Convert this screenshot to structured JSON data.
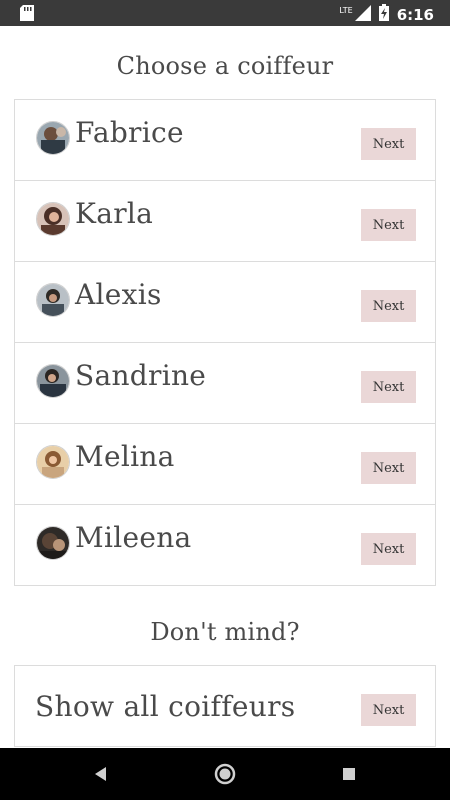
{
  "statusbar": {
    "network": "LTE",
    "time": "6:16"
  },
  "title": "Choose a coiffeur",
  "coiffeurs": [
    {
      "name": "Fabrice",
      "next_label": "Next",
      "avatar_color": "#6b7d8a"
    },
    {
      "name": "Karla",
      "next_label": "Next",
      "avatar_color": "#7a5a4c"
    },
    {
      "name": "Alexis",
      "next_label": "Next",
      "avatar_color": "#5e6870"
    },
    {
      "name": "Sandrine",
      "next_label": "Next",
      "avatar_color": "#4e5864"
    },
    {
      "name": "Melina",
      "next_label": "Next",
      "avatar_color": "#b58a64"
    },
    {
      "name": "Mileena",
      "next_label": "Next",
      "avatar_color": "#3e3a36"
    }
  ],
  "dont_mind": {
    "title": "Don't mind?",
    "label": "Show all coiffeurs",
    "next_label": "Next"
  },
  "colors": {
    "next_button_bg": "#ead7d7",
    "text": "#4a4a4a",
    "border": "#dcdcdc",
    "statusbar": "#3a3a3a"
  },
  "icons": {
    "status_left": "sd-card-icon",
    "signal": "cell-signal-icon",
    "battery": "battery-charging-icon",
    "nav_back": "back-triangle-icon",
    "nav_home": "home-circle-icon",
    "nav_recents": "recents-square-icon"
  }
}
